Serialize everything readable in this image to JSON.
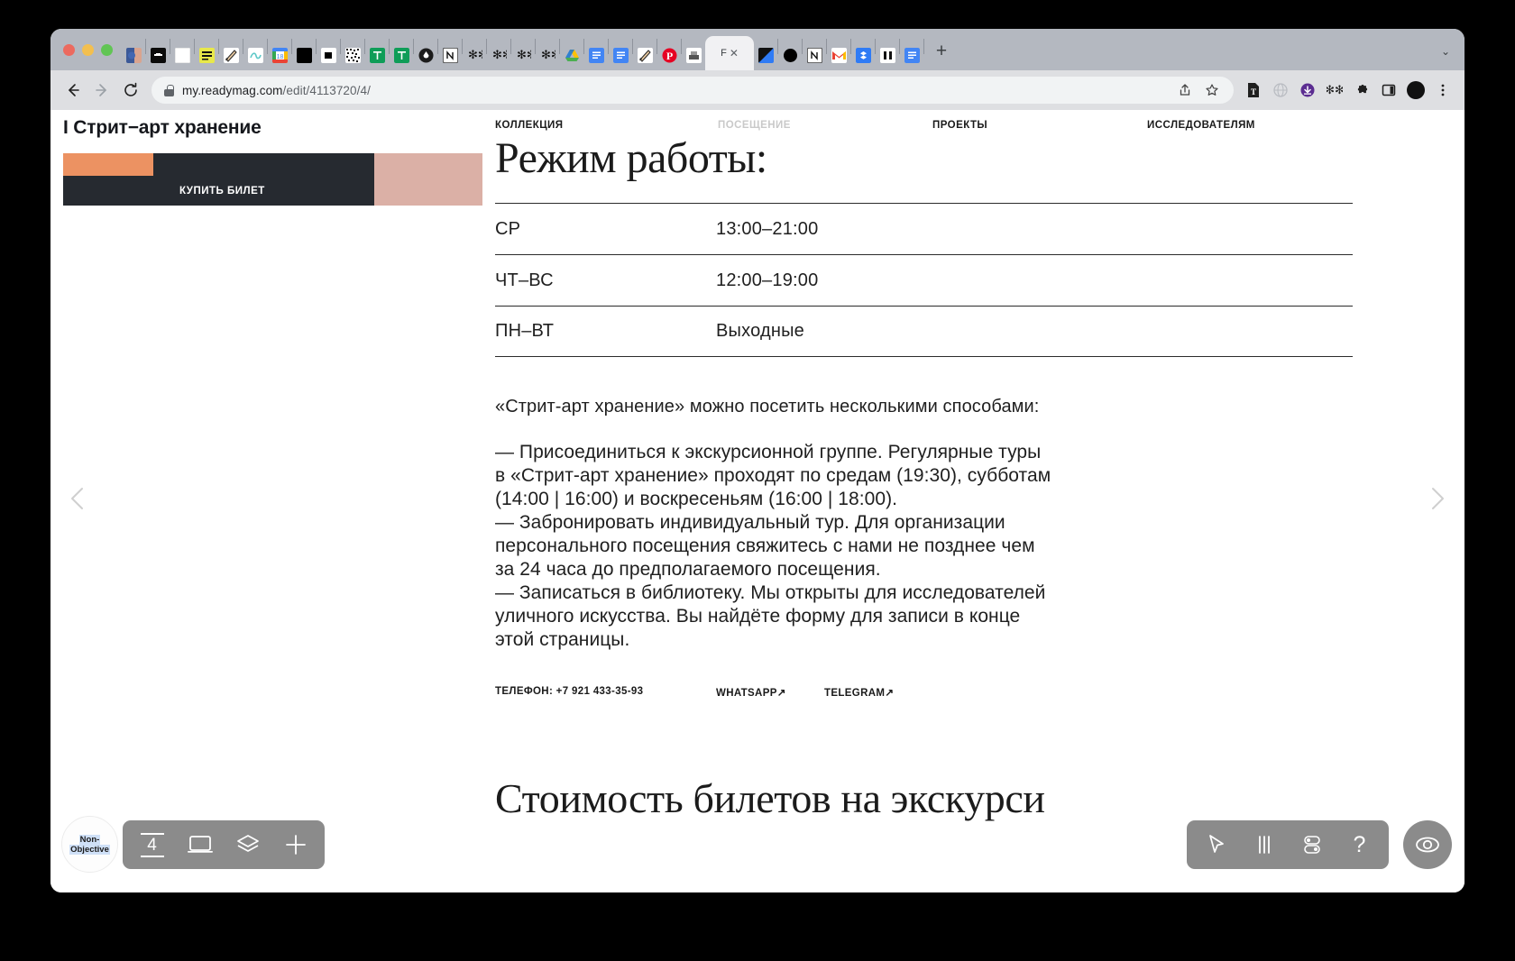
{
  "browser": {
    "url_host": "my.readymag.com",
    "url_path": "/edit/4113720/4/",
    "active_tab_label": "F",
    "active_tab_close": "✕",
    "new_tab_label": "+",
    "tab_list_chevron": "⌄",
    "back_label": "←",
    "forward_label": "→",
    "reload_label": "⟳",
    "share_label": "⇪",
    "bookmark_label": "☆",
    "menu_label": "⋮",
    "pinned_tabs": [
      {
        "name": "facebook-messenger-tab"
      },
      {
        "name": "black-note-tab"
      },
      {
        "name": "white-blank-tab"
      },
      {
        "name": "yellow-sticky-tab"
      },
      {
        "name": "drawing-hand-tab"
      },
      {
        "name": "teal-scribble-tab"
      },
      {
        "name": "google-calendar-tab"
      },
      {
        "name": "black-square-tab"
      },
      {
        "name": "small-black-square-tab"
      },
      {
        "name": "qr-noise-tab"
      },
      {
        "name": "google-sheets-tab"
      },
      {
        "name": "google-sheets-2-tab"
      },
      {
        "name": "dark-drop-tab"
      },
      {
        "name": "notion-tab"
      },
      {
        "name": "asterisk-tab"
      },
      {
        "name": "asterisk-2-tab"
      },
      {
        "name": "asterisk-3-tab"
      },
      {
        "name": "asterisk-4-tab"
      },
      {
        "name": "google-drive-tab"
      },
      {
        "name": "google-docs-tab"
      },
      {
        "name": "google-docs-2-tab"
      },
      {
        "name": "drawing-hand-2-tab"
      },
      {
        "name": "pinterest-tab"
      },
      {
        "name": "printer-tab"
      }
    ],
    "trailing_tabs": [
      {
        "name": "blue-triangle-tab"
      },
      {
        "name": "black-circle-tab"
      },
      {
        "name": "notion-2-tab"
      },
      {
        "name": "gmail-tab"
      },
      {
        "name": "dropbox-tab"
      },
      {
        "name": "pause-tab"
      },
      {
        "name": "google-docs-3-tab"
      }
    ],
    "toolbar_extensions": [
      {
        "name": "translate-extension-icon"
      },
      {
        "name": "globe-extension-icon"
      },
      {
        "name": "download-extension-icon"
      },
      {
        "name": "asterisk-extension-icon"
      },
      {
        "name": "puzzle-extensions-icon"
      },
      {
        "name": "side-panel-icon"
      },
      {
        "name": "profile-avatar-icon"
      }
    ]
  },
  "site": {
    "title": "I Стрит−арт хранение",
    "nav": [
      {
        "label": "КОЛЛЕКЦИЯ",
        "active": false
      },
      {
        "label": "ПОСЕЩЕНИЕ",
        "active": true
      },
      {
        "label": "ПРОЕКТЫ",
        "active": false
      },
      {
        "label": "ИССЛЕДОВАТЕЛЯМ",
        "active": false
      }
    ],
    "ticket_button": "КУПИТЬ БИЛЕТ",
    "colors": {
      "banner_bg": "#dbb0a6",
      "banner_accent": "#ec9262",
      "banner_bar": "#262a30",
      "nav_active": "#c9c9c9"
    },
    "heading": "Режим работы:",
    "schedule": [
      {
        "days": "СР",
        "hours": "13:00–21:00"
      },
      {
        "days": "ЧТ–ВС",
        "hours": "12:00–19:00"
      },
      {
        "days": "ПН–ВТ",
        "hours": "Выходные"
      }
    ],
    "lead": "«Стрит-арт хранение» можно посетить несколькими способами:",
    "body": "— Присоединиться к экскурсионной группе. Регулярные туры\nв «Стрит-арт хранение» проходят по средам (19:30), субботам\n(14:00 | 16:00) и воскресеньям (16:00 | 18:00).\n— Забронировать индивидуальный тур. Для организации\nперсонального посещения свяжитесь с нами не позднее чем\nза 24 часа до предполагаемого посещения.\n— Записаться в библиотеку. Мы открыты для исследователей\nуличного искусства. Вы найдёте форму для записи в конце\nэтой страницы.",
    "contacts": [
      {
        "label": "ТЕЛЕФОН: +7 921 433-35-93"
      },
      {
        "label": "WHATSAPP↗"
      },
      {
        "label": "TELEGRAM↗"
      }
    ],
    "heading2": "Стоимость билетов на экскурси",
    "prev_arrow": "‹",
    "next_arrow": "›"
  },
  "editor": {
    "avatar_line1": "Non-",
    "avatar_line2": "Objective",
    "page_number": "4",
    "left_tools": [
      {
        "name": "page-number-tool"
      },
      {
        "name": "desktop-preview-tool"
      },
      {
        "name": "layers-tool"
      },
      {
        "name": "add-tool"
      }
    ],
    "right_tools": [
      {
        "name": "pointer-tool"
      },
      {
        "name": "columns-tool"
      },
      {
        "name": "toggles-tool"
      },
      {
        "name": "help-tool"
      }
    ],
    "help_label": "?",
    "plus_label": "+",
    "preview_tool": {
      "name": "preview-eye-tool"
    }
  }
}
